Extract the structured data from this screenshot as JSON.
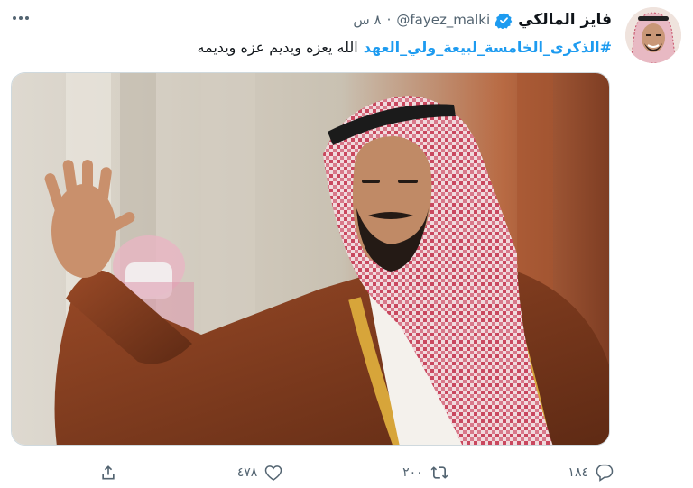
{
  "tweet": {
    "display_name": "فايز المالكي",
    "handle": "@fayez_malki",
    "separator": "·",
    "time": "٨ س",
    "hashtag": "#الذكرى_الخامسة_لبيعة_ولي_العهد",
    "text": "الله يعزه ويديم عزه ويديمه"
  },
  "actions": {
    "reply_count": "١٨٤",
    "retweet_count": "٢٠٠",
    "like_count": "٤٧٨"
  },
  "colors": {
    "accent": "#1d9bf0",
    "muted": "#536471",
    "verified": "#1d9bf0"
  }
}
